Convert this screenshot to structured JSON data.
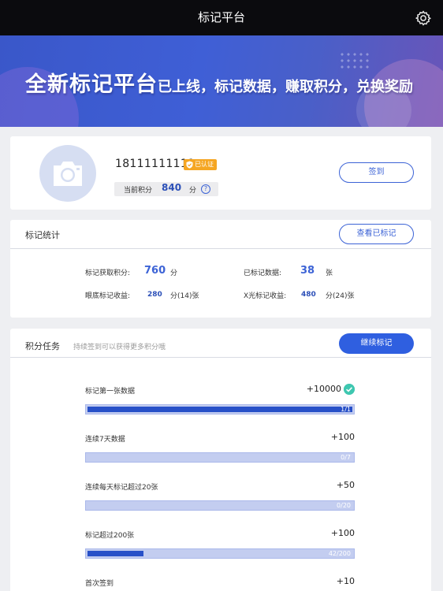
{
  "header": {
    "title": "标记平台",
    "settings_icon": "gear-icon"
  },
  "banner": {
    "headline": "全新标记平台",
    "subline": "已上线，标记数据，赚取积分，兑换奖励"
  },
  "profile": {
    "phone": "18111111111",
    "verified_badge": "已认证",
    "points_label": "当前积分",
    "points_value": "840",
    "points_unit": "分",
    "help_symbol": "?",
    "checkin_button": "签到"
  },
  "stats": {
    "title": "标记统计",
    "view_button": "查看已标记",
    "earned_label": "标记获取积分:",
    "earned_value": "760",
    "earned_unit": "分",
    "marked_label": "已标记数据:",
    "marked_value": "38",
    "marked_unit": "张",
    "fundus_label": "眼底标记收益:",
    "fundus_value": "280",
    "fundus_unit": "分(14)张",
    "xray_label": "X光标记收益:",
    "xray_value": "480",
    "xray_unit": "分(24)张"
  },
  "tasks": {
    "title": "积分任务",
    "hint": "持续签到可以获得更多积分哦",
    "continue_button": "继续标记",
    "items": [
      {
        "name": "标记第一张数据",
        "reward": "+10000",
        "progress_text": "1/1",
        "progress": 1.0,
        "completed": true
      },
      {
        "name": "连续7天数据",
        "reward": "+100",
        "progress_text": "0/7",
        "progress": 0.0,
        "completed": false
      },
      {
        "name": "连续每天标记超过20张",
        "reward": "+50",
        "progress_text": "0/20",
        "progress": 0.0,
        "completed": false
      },
      {
        "name": "标记超过200张",
        "reward": "+100",
        "progress_text": "42/200",
        "progress": 0.21,
        "completed": false
      },
      {
        "name": "首次签到",
        "reward": "+10",
        "completed": false
      }
    ]
  },
  "colors": {
    "accent": "#3c63d6",
    "topbar": "#0b0b0e",
    "progress_fill": "#2750c8",
    "progress_track": "#c3cdf0",
    "check": "#3ec7b0",
    "badge": "#f5a623"
  }
}
